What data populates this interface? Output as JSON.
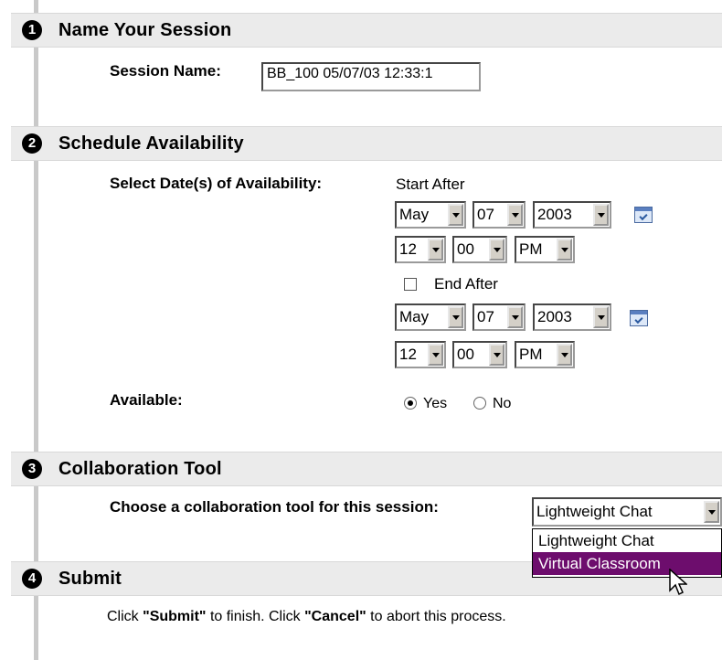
{
  "sections": {
    "s1": {
      "num": "1",
      "title": "Name Your Session"
    },
    "s2": {
      "num": "2",
      "title": "Schedule Availability"
    },
    "s3": {
      "num": "3",
      "title": "Collaboration Tool"
    },
    "s4": {
      "num": "4",
      "title": "Submit"
    }
  },
  "session": {
    "label": "Session Name:",
    "value": "BB_100 05/07/03 12:33:1"
  },
  "availability": {
    "label": "Select Date(s) of Availability:",
    "start_label": "Start After",
    "start": {
      "month": "May",
      "day": "07",
      "year": "2003",
      "hour": "12",
      "minute": "00",
      "ampm": "PM"
    },
    "end_label": "End After",
    "end_checked": false,
    "end": {
      "month": "May",
      "day": "07",
      "year": "2003",
      "hour": "12",
      "minute": "00",
      "ampm": "PM"
    },
    "available_label": "Available:",
    "yes_label": "Yes",
    "no_label": "No",
    "available": "Yes"
  },
  "collaboration": {
    "label": "Choose a collaboration tool for this session:",
    "selected": "Lightweight Chat",
    "options": [
      "Lightweight Chat",
      "Virtual Classroom"
    ],
    "highlighted": "Virtual Classroom"
  },
  "submit": {
    "part1": "Click ",
    "submit_word": "\"Submit\"",
    "part2": " to finish. Click ",
    "cancel_word": "\"Cancel\"",
    "part3": " to abort this process."
  },
  "icons": {
    "calendar": "calendar-icon",
    "cursor": "mouse-pointer-icon"
  },
  "colors": {
    "header_bg": "#ebebeb",
    "highlight": "#6d0d6d",
    "rail": "#c9c9c9"
  }
}
